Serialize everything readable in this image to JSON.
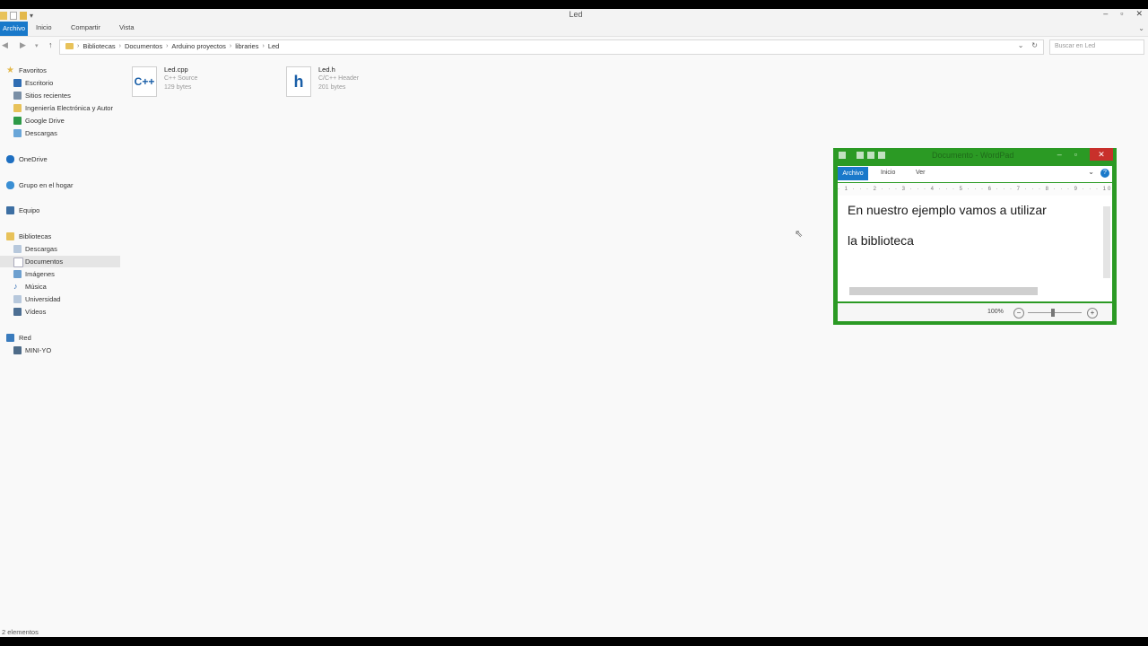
{
  "explorer": {
    "title": "Led",
    "ribbon": {
      "file": "Archivo",
      "tabs": [
        "Inicio",
        "Compartir",
        "Vista"
      ]
    },
    "breadcrumb": [
      "Bibliotecas",
      "Documentos",
      "Arduino proyectos",
      "libraries",
      "Led"
    ],
    "search_placeholder": "Buscar en Led",
    "nav": {
      "favorites": "Favoritos",
      "favorites_items": [
        "Escritorio",
        "Sitios recientes",
        "Ingeniería Electrónica y Autor",
        "Google Drive",
        "Descargas"
      ],
      "onedrive": "OneDrive",
      "homegroup": "Grupo en el hogar",
      "computer": "Equipo",
      "libraries": "Bibliotecas",
      "libraries_items": [
        "Descargas",
        "Documentos",
        "Imágenes",
        "Música",
        "Universidad",
        "Vídeos"
      ],
      "network": "Red",
      "network_items": [
        "MINI-YO"
      ]
    },
    "files": [
      {
        "name": "Led.cpp",
        "type": "C++ Source",
        "size": "129 bytes",
        "icon_text": "C++"
      },
      {
        "name": "Led.h",
        "type": "C/C++ Header",
        "size": "201 bytes",
        "icon_text": "h"
      }
    ],
    "status": "2 elementos"
  },
  "wordpad": {
    "title": "Documento - WordPad",
    "file_tab": "Archivo",
    "tabs": [
      "Inicio",
      "Ver"
    ],
    "ruler": "· 1 · · · 2 · · · 3 · · · 4 · · · 5 · · · 6 · · · 7 · · · 8 · · · 9 · · · 10 · · · 11",
    "lines": [
      "En nuestro ejemplo vamos a utilizar",
      "la biblioteca"
    ],
    "zoom": "100%"
  },
  "colors": {
    "accent": "#1979ca",
    "wordpad_frame": "#2b9a24",
    "close": "#c8302b"
  }
}
